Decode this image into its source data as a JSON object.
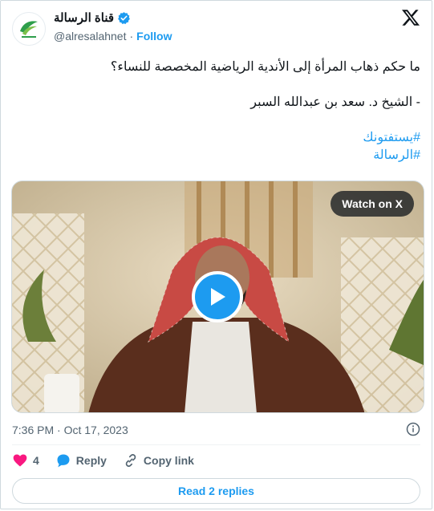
{
  "header": {
    "display_name": "قناة الرسالة",
    "handle": "@alresalahnet",
    "separator": "·",
    "follow_label": "Follow"
  },
  "tweet": {
    "lines": [
      "ما حكم ذهاب المرأة إلى الأندية الرياضية المخصصة للنساء؟",
      "- الشيخ د. سعد بن عبدالله السبر"
    ],
    "hashtags": [
      "#يستفتونك",
      "#الرسالة"
    ]
  },
  "media": {
    "watch_label": "Watch on X"
  },
  "meta": {
    "timestamp": "7:36 PM · Oct 17, 2023"
  },
  "actions": {
    "likes_count": "4",
    "reply_label": "Reply",
    "copy_link_label": "Copy link"
  },
  "replies": {
    "read_label": "Read 2 replies"
  },
  "colors": {
    "accent": "#1d9bf0",
    "like": "#f91880",
    "text": "#0f1419",
    "muted": "#536471"
  }
}
